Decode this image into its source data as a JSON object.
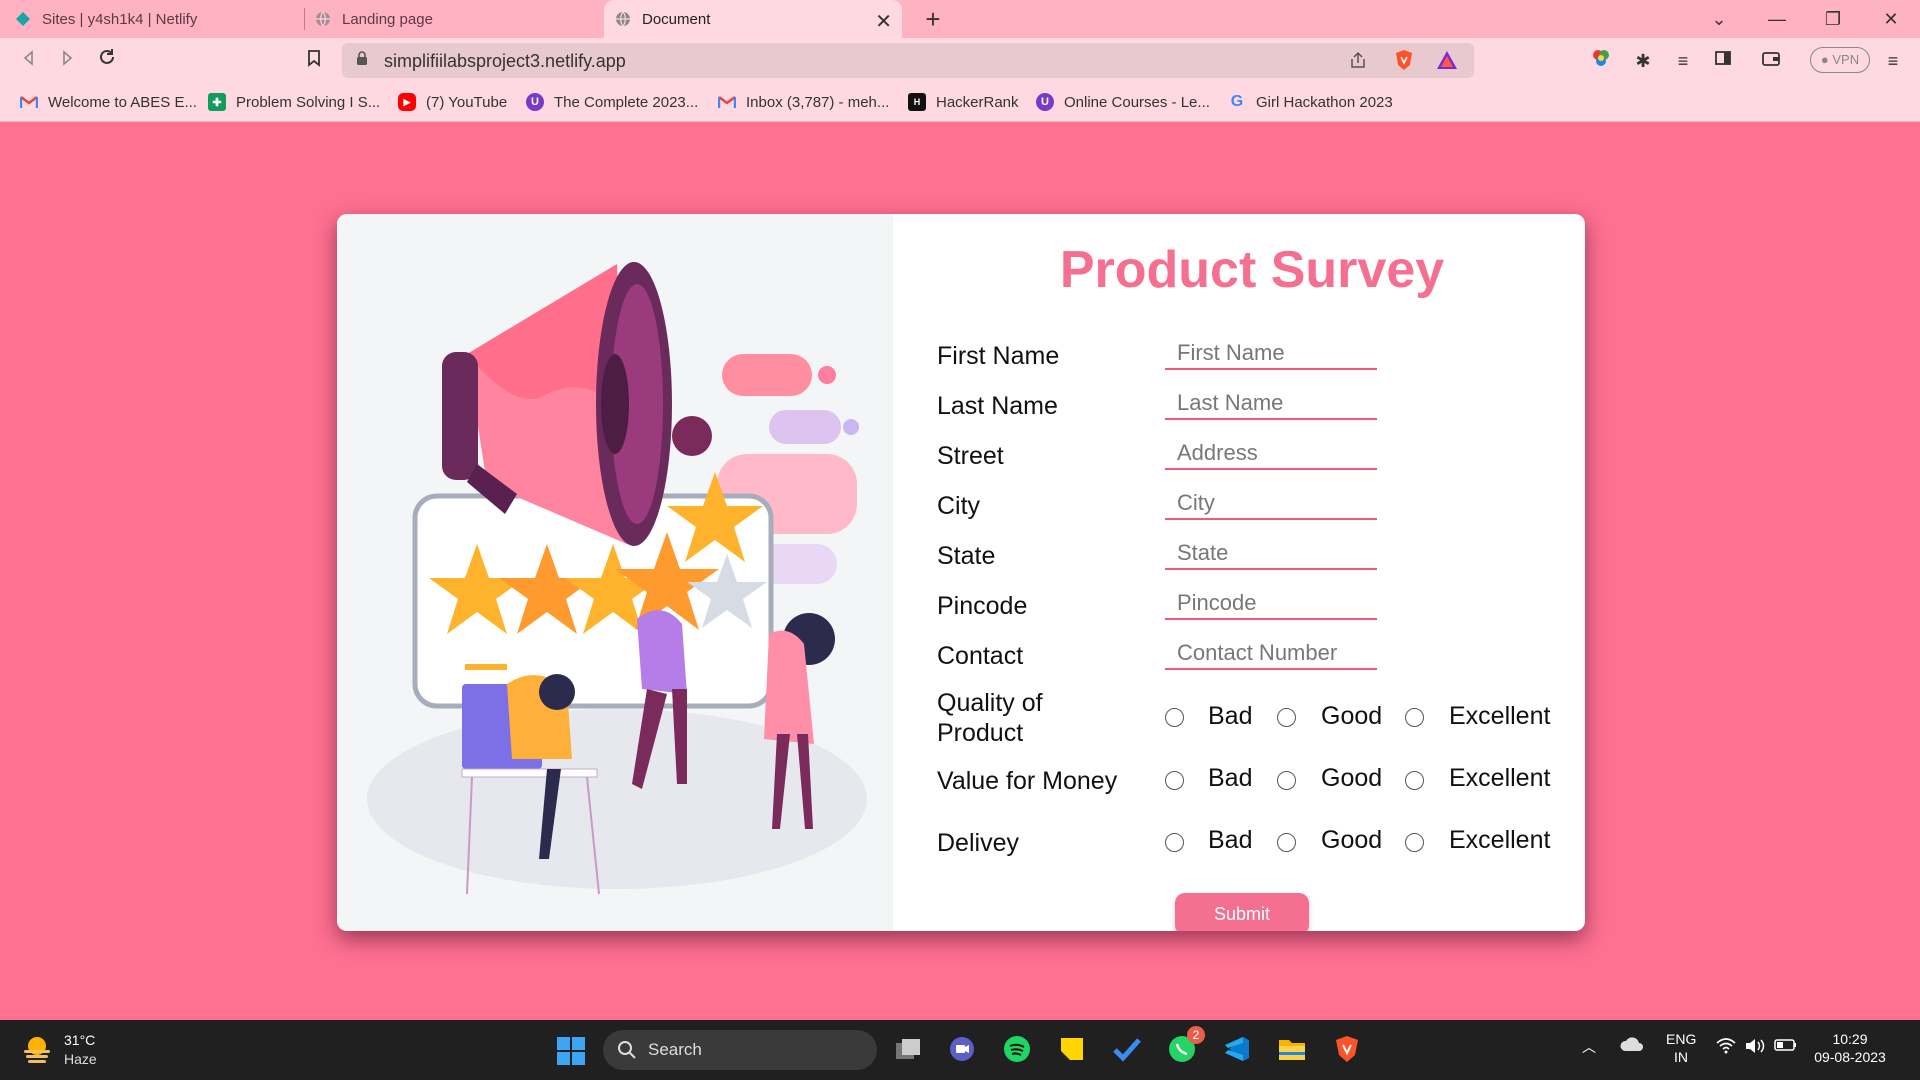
{
  "browser": {
    "tabs": [
      {
        "title": "Sites | y4sh1k4 | Netlify",
        "active": false
      },
      {
        "title": "Landing page",
        "active": false
      },
      {
        "title": "Document",
        "active": true
      }
    ],
    "url": "simplifiilabsproject3.netlify.app",
    "vpn_label": "VPN",
    "bookmarks": [
      {
        "label": "Welcome to ABES E...",
        "icon": "gmail-icon"
      },
      {
        "label": "Problem Solving I S...",
        "icon": "sheets-icon"
      },
      {
        "label": "(7) YouTube",
        "icon": "youtube-icon"
      },
      {
        "label": "The Complete 2023...",
        "icon": "udemy-icon"
      },
      {
        "label": "Inbox (3,787) - meh...",
        "icon": "gmail-icon"
      },
      {
        "label": "HackerRank",
        "icon": "hackerrank-icon"
      },
      {
        "label": "Online Courses - Le...",
        "icon": "udemy-icon"
      },
      {
        "label": "Girl Hackathon 2023",
        "icon": "google-icon"
      }
    ]
  },
  "survey": {
    "title": "Product Survey",
    "fields": [
      {
        "label": "First Name",
        "placeholder": "First Name"
      },
      {
        "label": "Last Name",
        "placeholder": "Last Name"
      },
      {
        "label": "Street",
        "placeholder": "Address"
      },
      {
        "label": "City",
        "placeholder": "City"
      },
      {
        "label": "State",
        "placeholder": "State"
      },
      {
        "label": "Pincode",
        "placeholder": "Pincode"
      },
      {
        "label": "Contact",
        "placeholder": "Contact Number"
      }
    ],
    "ratings": [
      {
        "label_line1": "Quality of",
        "label_line2": "Product"
      },
      {
        "label_line1": "Value for Money",
        "label_line2": ""
      },
      {
        "label_line1": "Delivey",
        "label_line2": ""
      }
    ],
    "options": [
      "Bad",
      "Good",
      "Excellent"
    ],
    "submit_label": "Submit"
  },
  "taskbar": {
    "temperature": "31°C",
    "weather": "Haze",
    "search_label": "Search",
    "whatsapp_badge": "2",
    "lang_line1": "ENG",
    "lang_line2": "IN",
    "time": "10:29",
    "date": "09-08-2023"
  },
  "colors": {
    "page_bg": "#ff7091",
    "accent": "#f56f91",
    "input_underline": "#f2577d"
  }
}
